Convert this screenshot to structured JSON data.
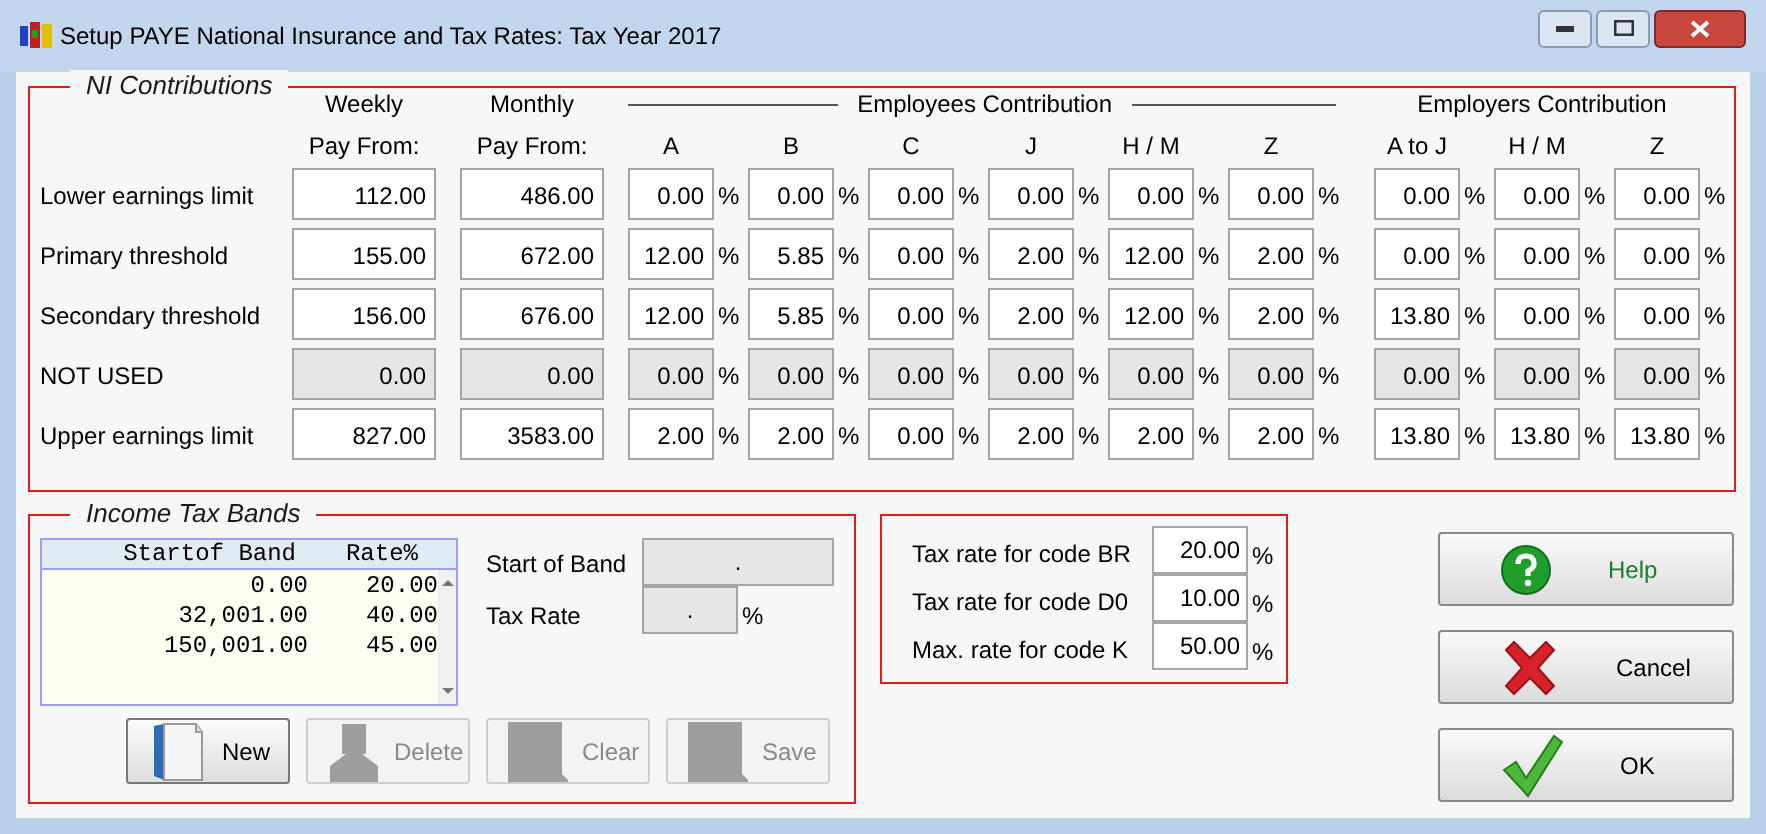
{
  "window": {
    "title": "Setup PAYE National Insurance and Tax Rates: Tax Year 2017"
  },
  "ni_contributions": {
    "title": "NI Contributions",
    "weekly_heading": [
      "Weekly",
      "Pay From:"
    ],
    "monthly_heading": [
      "Monthly",
      "Pay From:"
    ],
    "employees_heading": "Employees Contribution",
    "employees_columns": [
      "A",
      "B",
      "C",
      "J",
      "H / M",
      "Z"
    ],
    "employers_heading": "Employers Contribution",
    "employers_columns": [
      "A to J",
      "H / M",
      "Z"
    ],
    "rows": [
      {
        "label": "Lower earnings limit",
        "disabled": false,
        "weekly": "112.00",
        "monthly": "486.00",
        "employees": [
          {
            "value": "0.00",
            "unit": "%"
          },
          {
            "value": "0.00",
            "unit": "%"
          },
          {
            "value": "0.00",
            "unit": "%"
          },
          {
            "value": "0.00",
            "unit": "%"
          },
          {
            "value": "0.00",
            "unit": "%"
          },
          {
            "value": "0.00",
            "unit": "%"
          }
        ],
        "employers": [
          {
            "value": "0.00",
            "unit": "%"
          },
          {
            "value": "0.00",
            "unit": "%"
          },
          {
            "value": "0.00",
            "unit": "%"
          }
        ]
      },
      {
        "label": "Primary threshold",
        "disabled": false,
        "weekly": "155.00",
        "monthly": "672.00",
        "employees": [
          {
            "value": "12.00",
            "unit": "%"
          },
          {
            "value": "5.85",
            "unit": "%"
          },
          {
            "value": "0.00",
            "unit": "%"
          },
          {
            "value": "2.00",
            "unit": "%"
          },
          {
            "value": "12.00",
            "unit": "%"
          },
          {
            "value": "2.00",
            "unit": "%"
          }
        ],
        "employers": [
          {
            "value": "0.00",
            "unit": "%"
          },
          {
            "value": "0.00",
            "unit": "%"
          },
          {
            "value": "0.00",
            "unit": "%"
          }
        ]
      },
      {
        "label": "Secondary threshold",
        "disabled": false,
        "weekly": "156.00",
        "monthly": "676.00",
        "employees": [
          {
            "value": "12.00",
            "unit": "%"
          },
          {
            "value": "5.85",
            "unit": "%"
          },
          {
            "value": "0.00",
            "unit": "%"
          },
          {
            "value": "2.00",
            "unit": "%"
          },
          {
            "value": "12.00",
            "unit": "%"
          },
          {
            "value": "2.00",
            "unit": "%"
          }
        ],
        "employers": [
          {
            "value": "13.80",
            "unit": "%"
          },
          {
            "value": "0.00",
            "unit": "%"
          },
          {
            "value": "0.00",
            "unit": "%"
          }
        ]
      },
      {
        "label": "NOT USED",
        "disabled": true,
        "weekly": "0.00",
        "monthly": "0.00",
        "employees": [
          {
            "value": "0.00",
            "unit": "%"
          },
          {
            "value": "0.00",
            "unit": "%"
          },
          {
            "value": "0.00",
            "unit": "%"
          },
          {
            "value": "0.00",
            "unit": "%"
          },
          {
            "value": "0.00",
            "unit": "%"
          },
          {
            "value": "0.00",
            "unit": "%"
          }
        ],
        "employers": [
          {
            "value": "0.00",
            "unit": "%"
          },
          {
            "value": "0.00",
            "unit": "%"
          },
          {
            "value": "0.00",
            "unit": "%"
          }
        ]
      },
      {
        "label": "Upper earnings limit",
        "disabled": false,
        "weekly": "827.00",
        "monthly": "3583.00",
        "employees": [
          {
            "value": "2.00",
            "unit": "%"
          },
          {
            "value": "2.00",
            "unit": "%"
          },
          {
            "value": "0.00",
            "unit": "%"
          },
          {
            "value": "2.00",
            "unit": "%"
          },
          {
            "value": "2.00",
            "unit": "%"
          },
          {
            "value": "2.00",
            "unit": "%"
          }
        ],
        "employers": [
          {
            "value": "13.80",
            "unit": "%"
          },
          {
            "value": "13.80",
            "unit": "%"
          },
          {
            "value": "13.80",
            "unit": "%"
          }
        ]
      }
    ]
  },
  "income_tax_bands": {
    "title": "Income Tax Bands",
    "list": {
      "columns": [
        "Startof Band",
        "Rate%"
      ],
      "rows": [
        {
          "start": "0.00",
          "rate": "20.00"
        },
        {
          "start": "32,001.00",
          "rate": "40.00"
        },
        {
          "start": "150,001.00",
          "rate": "45.00"
        }
      ]
    },
    "start_of_band": {
      "label": "Start of Band",
      "value": "."
    },
    "tax_rate": {
      "label": "Tax Rate",
      "value": ".",
      "unit": "%"
    },
    "buttons": [
      {
        "kind": "new",
        "label": "New",
        "disabled": false
      },
      {
        "kind": "delete",
        "label": "Delete",
        "disabled": true
      },
      {
        "kind": "clear",
        "label": "Clear",
        "disabled": true
      },
      {
        "kind": "save",
        "label": "Save",
        "disabled": true
      }
    ]
  },
  "tax_codes": [
    {
      "label": "Tax rate for code BR",
      "value": "20.00",
      "unit": "%"
    },
    {
      "label": "Tax rate for code D0",
      "value": "10.00",
      "unit": "%"
    },
    {
      "label": "Max. rate for code K",
      "value": "50.00",
      "unit": "%"
    }
  ],
  "actions": [
    {
      "kind": "help",
      "label": "Help"
    },
    {
      "kind": "cancel",
      "label": "Cancel"
    },
    {
      "kind": "ok",
      "label": "OK"
    }
  ]
}
